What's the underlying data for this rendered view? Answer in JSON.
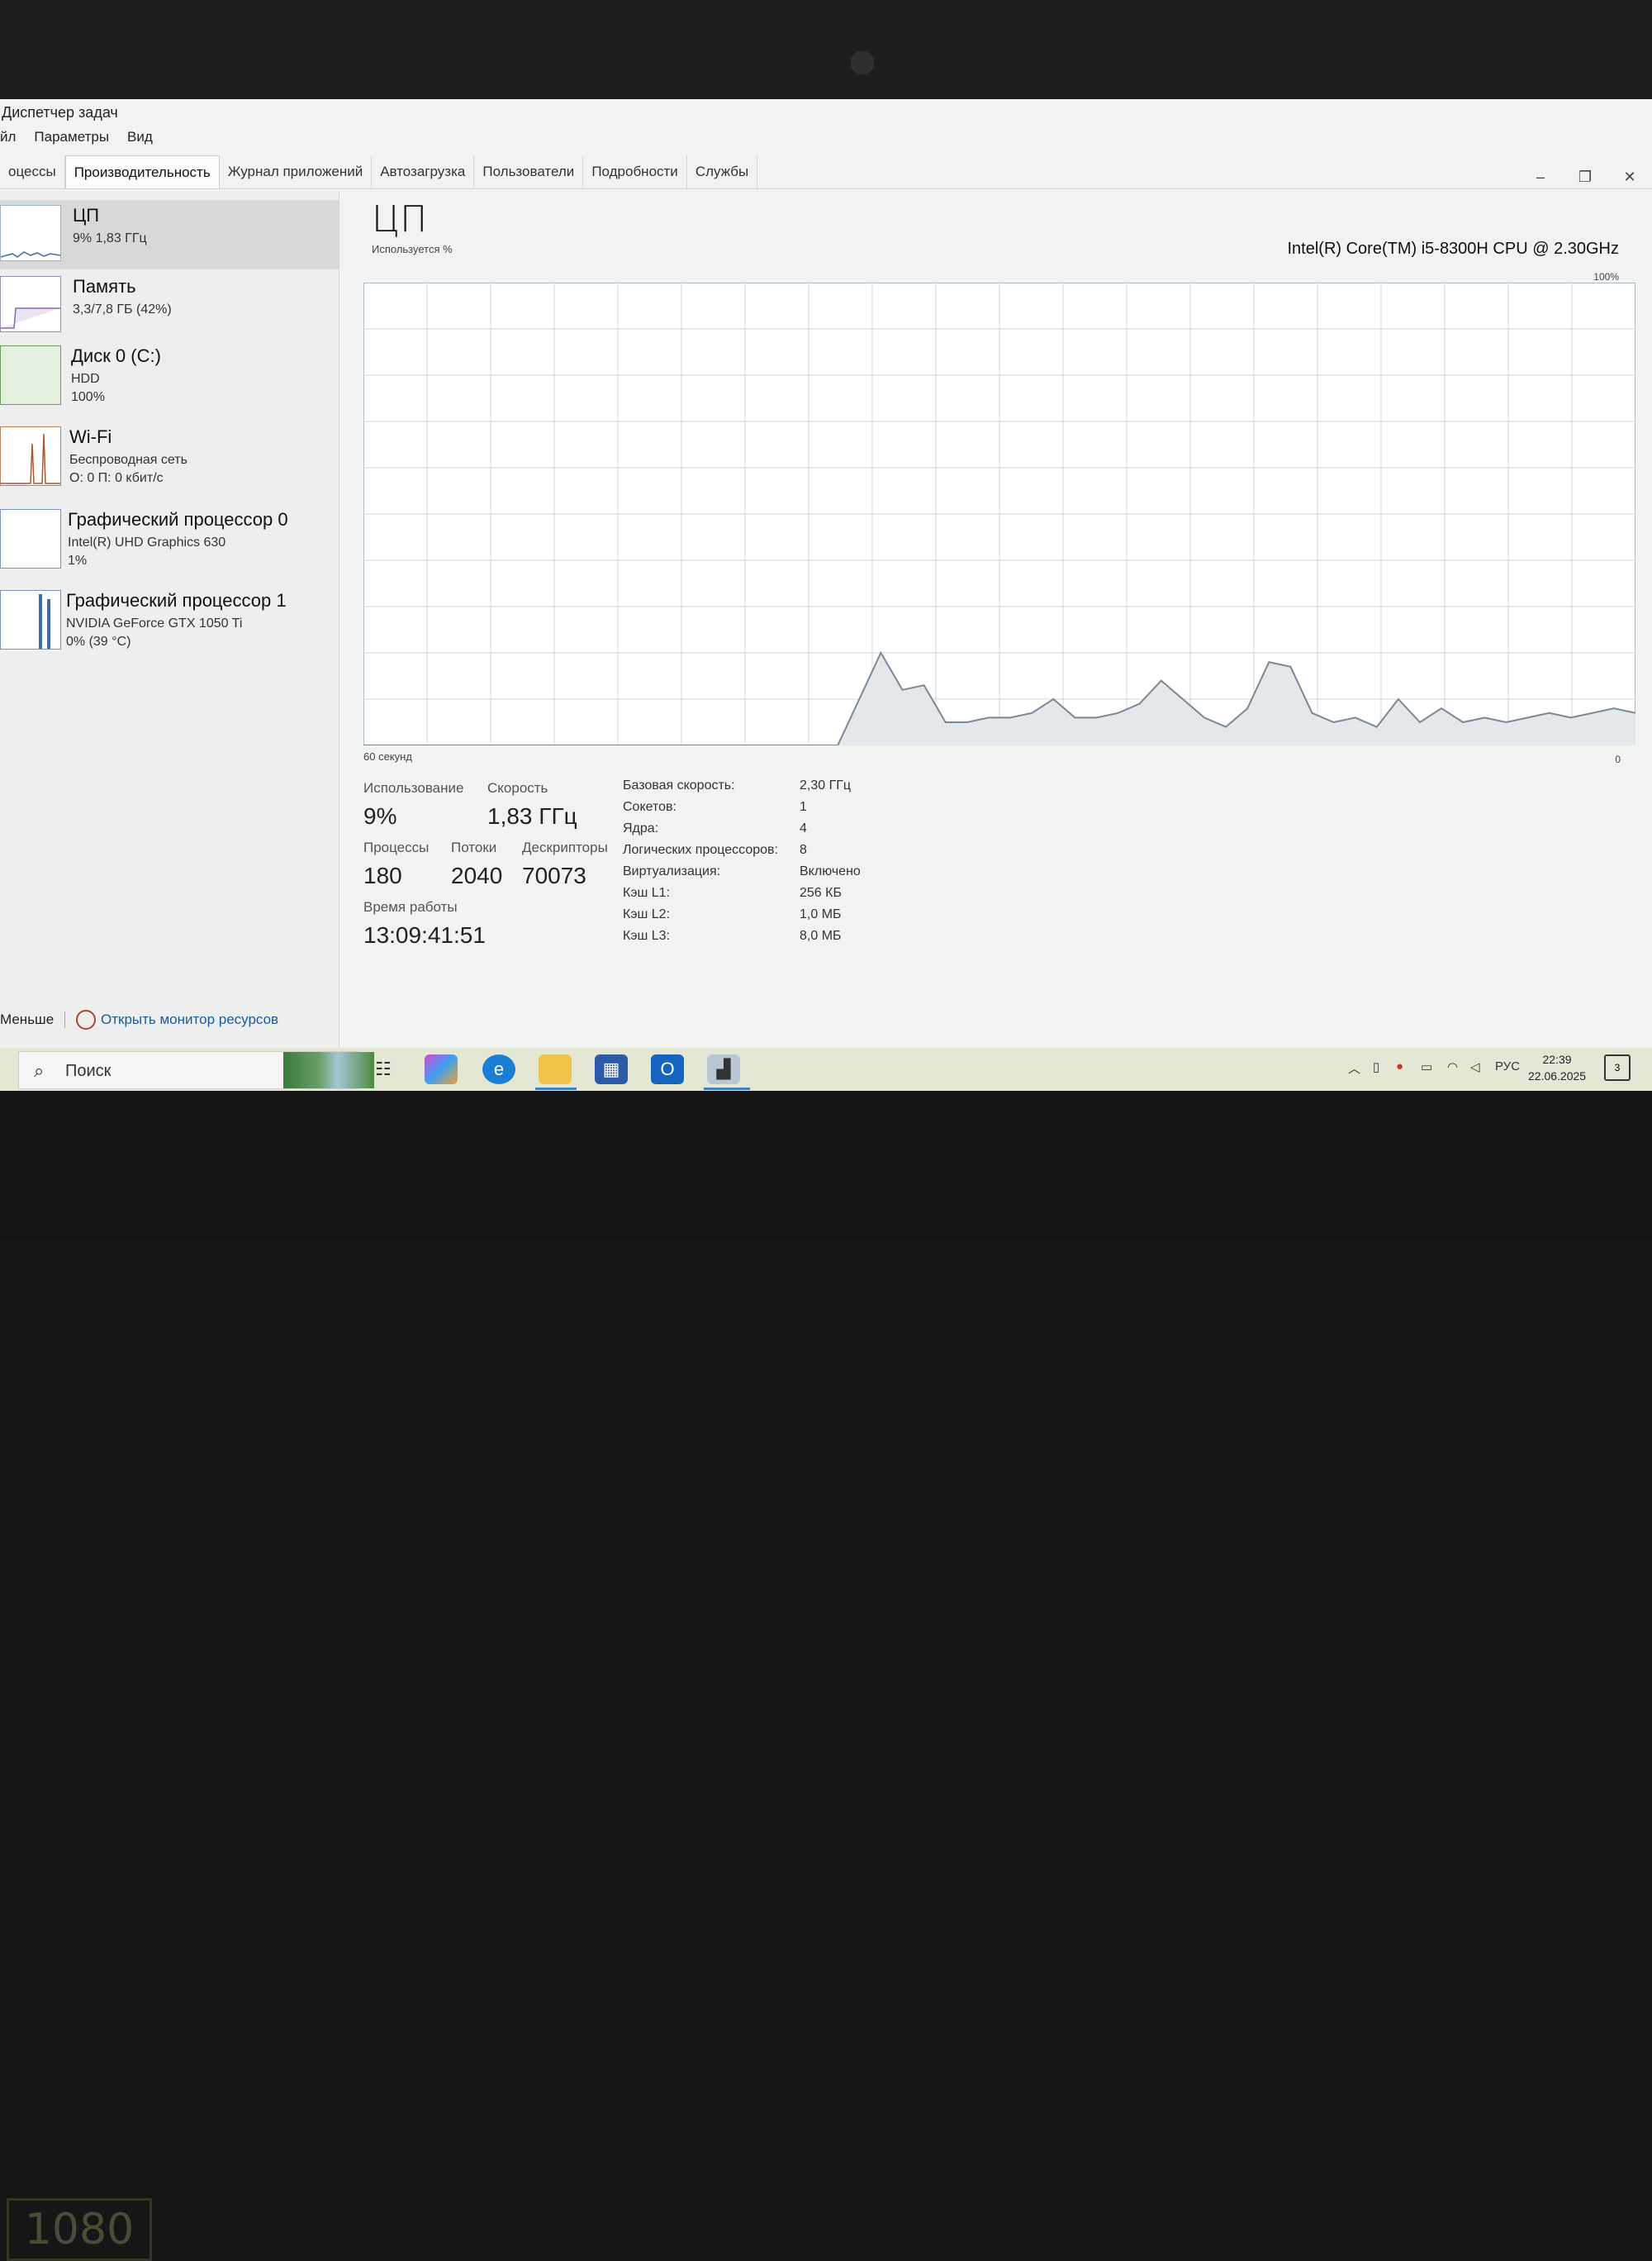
{
  "window": {
    "title": "Диспетчер задач",
    "menu": [
      "йл",
      "Параметры",
      "Вид"
    ],
    "tabs": [
      "оцессы",
      "Производительность",
      "Журнал приложений",
      "Автозагрузка",
      "Пользователи",
      "Подробности",
      "Службы"
    ],
    "active_tab": "Производительность"
  },
  "sidebar": {
    "items": [
      {
        "name": "ЦП",
        "line1": "9% 1,83 ГГц",
        "line2": ""
      },
      {
        "name": "Память",
        "line1": "3,3/7,8 ГБ (42%)",
        "line2": ""
      },
      {
        "name": "Диск 0 (C:)",
        "line1": "HDD",
        "line2": "100%"
      },
      {
        "name": "Wi-Fi",
        "line1": "Беспроводная сеть",
        "line2": "О: 0 П: 0 кбит/с"
      },
      {
        "name": "Графический процессор 0",
        "line1": "Intel(R) UHD Graphics 630",
        "line2": "1%"
      },
      {
        "name": "Графический процессор 1",
        "line1": "NVIDIA GeForce GTX 1050 Ti",
        "line2": "0% (39 °C)"
      }
    ]
  },
  "cpu": {
    "title": "ЦП",
    "model": "Intel(R) Core(TM) i5-8300H CPU @ 2.30GHz",
    "usage_label": "Используется %",
    "max_label": "100%",
    "time_label": "60 секунд",
    "min_label": "0",
    "usage": {
      "label": "Использование",
      "value": "9%"
    },
    "speed": {
      "label": "Скорость",
      "value": "1,83 ГГц"
    },
    "processes": {
      "label": "Процессы",
      "value": "180"
    },
    "threads": {
      "label": "Потоки",
      "value": "2040"
    },
    "handles": {
      "label": "Дескрипторы",
      "value": "70073"
    },
    "uptime": {
      "label": "Время работы",
      "value": "13:09:41:51"
    },
    "details": [
      {
        "k": "Базовая скорость:",
        "v": "2,30 ГГц"
      },
      {
        "k": "Сокетов:",
        "v": "1"
      },
      {
        "k": "Ядра:",
        "v": "4"
      },
      {
        "k": "Логических процессоров:",
        "v": "8"
      },
      {
        "k": "Виртуализация:",
        "v": "Включено"
      },
      {
        "k": "Кэш L1:",
        "v": "256 КБ"
      },
      {
        "k": "Кэш L2:",
        "v": "1,0 МБ"
      },
      {
        "k": "Кэш L3:",
        "v": "8,0 МБ"
      }
    ],
    "history_percent": [
      0,
      0,
      0,
      0,
      0,
      0,
      0,
      0,
      0,
      0,
      0,
      0,
      0,
      0,
      0,
      0,
      0,
      0,
      0,
      0,
      0,
      0,
      0,
      10,
      20,
      12,
      13,
      5,
      5,
      6,
      6,
      7,
      10,
      6,
      6,
      7,
      9,
      14,
      10,
      6,
      4,
      8,
      18,
      17,
      7,
      5,
      6,
      4,
      10,
      5,
      8,
      5,
      6,
      5,
      6,
      7,
      6,
      7,
      8,
      7
    ]
  },
  "footer": {
    "less": "Меньше",
    "monitor_link": "Открыть монитор ресурсов"
  },
  "taskbar": {
    "search_placeholder": "Поиск",
    "lang": "РУС",
    "time": "22:39",
    "date": "22.06.2025",
    "notifications": "3"
  },
  "device": {
    "resolution_badge": "1080"
  },
  "colors": {
    "accent": "#3b82c4",
    "graph_line": "#7b8791",
    "graph_grid": "#cfd6dc"
  }
}
